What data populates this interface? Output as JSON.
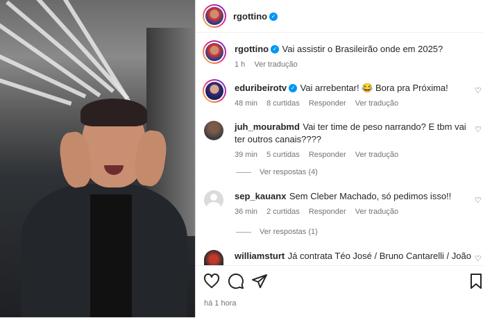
{
  "post": {
    "author": "rgottino",
    "caption": "Vai assistir o Brasileirão onde em 2025?",
    "caption_time": "1 h",
    "caption_translate": "Ver tradução",
    "posted_ago": "há 1 hora"
  },
  "comments": [
    {
      "username": "eduribeirotv",
      "verified": true,
      "text": "Vai arrebentar! 😂 Bora pra Próxima!",
      "time": "48 min",
      "likes": "8 curtidas",
      "reply": "Responder",
      "translate": "Ver tradução"
    },
    {
      "username": "juh_mourabmd",
      "verified": false,
      "text": "Vai ter time de peso narrando? E tbm vai ter outros canais????",
      "time": "39 min",
      "likes": "5 curtidas",
      "reply": "Responder",
      "translate": "Ver tradução",
      "view_replies": "Ver respostas (4)"
    },
    {
      "username": "sep_kauanx",
      "verified": false,
      "text": "Sem Cleber Machado, só pedimos isso!!",
      "time": "36 min",
      "likes": "2 curtidas",
      "reply": "Responder",
      "translate": "Ver tradução",
      "view_replies": "Ver respostas (1)"
    },
    {
      "username": "williamsturt",
      "verified": false,
      "text": "Já contrata Téo José / Bruno Cantarelli / João"
    }
  ],
  "icons": {
    "verified": "verified-badge-icon",
    "like": "heart-icon",
    "comment": "comment-icon",
    "share": "send-icon",
    "save": "bookmark-icon"
  },
  "colors": {
    "verified": "#0095f6",
    "meta": "#737373",
    "text": "#262626"
  }
}
